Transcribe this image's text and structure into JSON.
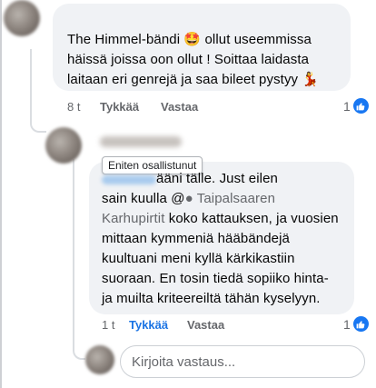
{
  "comment1": {
    "text": "The Himmel-bändi 🤩 ollut useemmissa häissä joissa oon ollut ! Soittaa laidasta laitaan eri genrejä ja saa bileet pystyy 💃",
    "time": "8 t",
    "like_label": "Tykkää",
    "reply_label": "Vastaa",
    "like_count": "1"
  },
  "comment2": {
    "tooltip": "Eniten osallistunut",
    "line1_suffix": "ääni tälle. Just eilen",
    "line2_prefix": "sain kuulla @",
    "mention_line2": "Taipalsaaren",
    "mention_line3": "Karhupirtit",
    "line3_suffix": " koko kattauksen, ja vuosien",
    "lines_rest": [
      "mittaan kymmeniä hääbändejä",
      "kuultuani meni kyllä kärkikastiin",
      "suoraan. En tosin tiedä sopiiko hinta-",
      "ja muilta kriteereiltä tähän kyselyyn."
    ],
    "time": "1 t",
    "like_label": "Tykkää",
    "reply_label": "Vastaa",
    "like_count": "1"
  },
  "reply": {
    "placeholder": "Kirjoita vastaus..."
  },
  "colors": {
    "bubble": "#f0f2f5",
    "accent": "#1b74e4",
    "muted": "#65676b"
  }
}
